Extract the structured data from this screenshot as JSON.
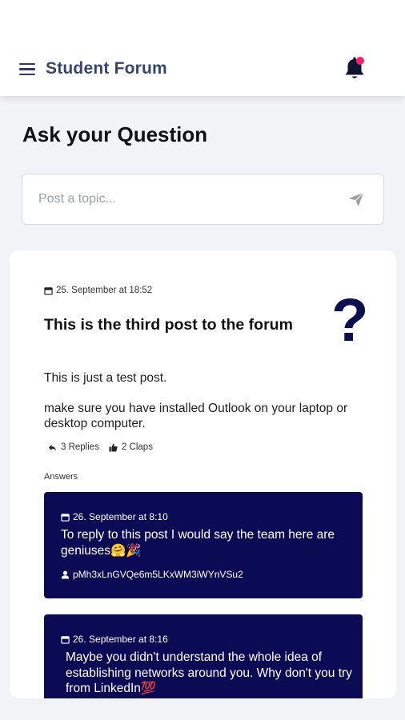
{
  "header": {
    "title": "Student Forum",
    "notification_dot_color": "#ff1f6d"
  },
  "page": {
    "heading": "Ask your Question",
    "post_input_placeholder": "Post a topic..."
  },
  "post": {
    "date": "25. September at 18:52",
    "title": "This is the third post to the forum",
    "question_mark": "?",
    "body": [
      "This is just a test post.",
      "make sure you have installed Outlook on your laptop or desktop computer."
    ],
    "replies": "3 Replies",
    "claps": "2 Claps",
    "answers_label": "Answers"
  },
  "answers": [
    {
      "date": "26. September at 8:10",
      "text": "To reply to this post I would say the team here are geniuses🤗🎉",
      "user": "pMh3xLnGVQe6m5LKxWM3iWYnVSu2"
    },
    {
      "date": "26. September at 8:16",
      "text": "Maybe you didn't understand the whole idea of establishing networks around you. Why don't you try from LinkedIn💯",
      "user": ""
    }
  ],
  "colors": {
    "answer_background": "#0a0a55",
    "title_color": "#344670"
  }
}
